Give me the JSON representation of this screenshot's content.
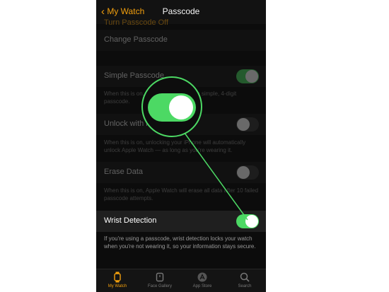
{
  "nav": {
    "back_label": "My Watch",
    "title": "Passcode"
  },
  "settings": {
    "turn_off_label": "Turn Passcode Off",
    "change_label": "Change Passcode",
    "simple_label": "Simple Passcode",
    "simple_desc": "When this is on, you can unlock with a simple, 4-digit passcode.",
    "simple_on": true,
    "unlock_label": "Unlock with iPhone",
    "unlock_desc": "When this is on, unlocking your iPhone will automatically unlock Apple Watch — as long as you're wearing it.",
    "unlock_on": false,
    "erase_label": "Erase Data",
    "erase_desc": "When this is on, Apple Watch will erase all data after 10 failed passcode attempts.",
    "erase_on": false,
    "wrist_label": "Wrist Detection",
    "wrist_desc": "If you're using a passcode, wrist detection locks your watch when you're not wearing it, so your information stays secure.",
    "wrist_on": true
  },
  "tabs": [
    {
      "label": "My Watch",
      "active": true
    },
    {
      "label": "Face Gallery",
      "active": false
    },
    {
      "label": "App Store",
      "active": false
    },
    {
      "label": "Search",
      "active": false
    }
  ],
  "colors": {
    "accent": "#f29f0d",
    "toggle_on": "#4cd964",
    "background": "#0c0c0c"
  }
}
